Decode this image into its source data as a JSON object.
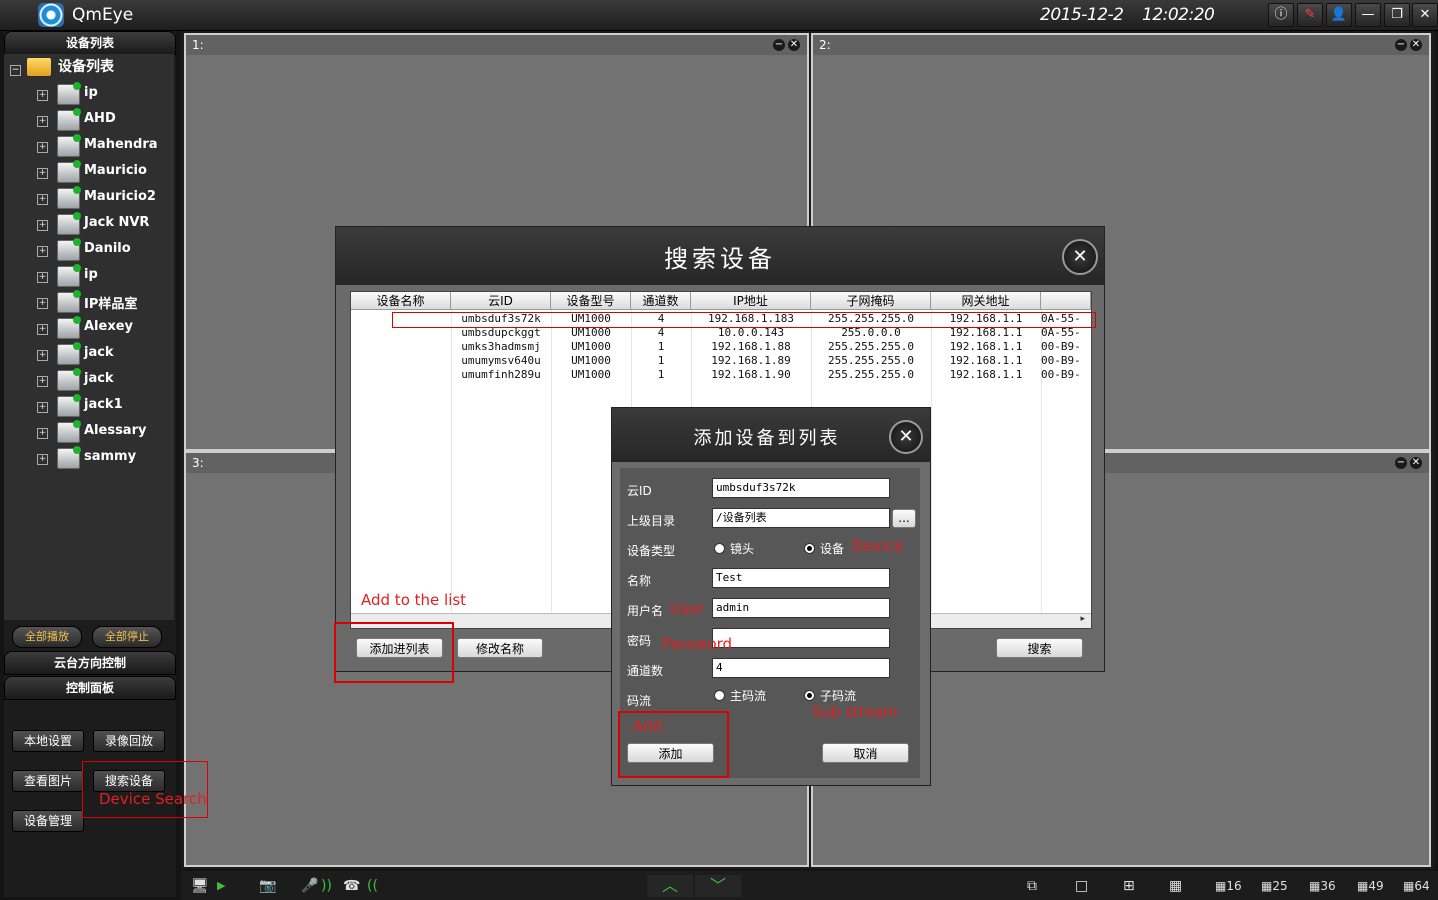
{
  "app": {
    "title": "QmEye",
    "date": "2015-12-2",
    "time": "12:02:20"
  },
  "titlebar_buttons": [
    {
      "name": "info-icon",
      "glyph": "ⓘ"
    },
    {
      "name": "lock-icon",
      "glyph": "✎"
    },
    {
      "name": "user-icon",
      "glyph": "👤"
    },
    {
      "name": "minimize-icon",
      "glyph": "—"
    },
    {
      "name": "restore-icon",
      "glyph": "❐"
    },
    {
      "name": "close-icon",
      "glyph": "✕"
    }
  ],
  "sidebar": {
    "header": "设备列表",
    "root_label": "设备列表",
    "devices": [
      "ip",
      "AHD",
      "Mahendra",
      "Mauricio",
      "Mauricio2",
      "Jack NVR",
      "Danilo",
      "ip",
      "IP样品室",
      "Alexey",
      "jack",
      "jack",
      "jack1",
      "Alessary",
      "sammy"
    ],
    "play_all": "全部播放",
    "stop_all": "全部停止",
    "ptz": "云台方向控制",
    "control_panel": "控制面板",
    "local_settings": "本地设置",
    "playback": "录像回放",
    "view_pictures": "查看图片",
    "search_device": "搜索设备",
    "device_management": "设备管理"
  },
  "panes": [
    "1:",
    "2:",
    "3:"
  ],
  "search_dialog": {
    "title": "搜索设备",
    "columns": [
      "设备名称",
      "云ID",
      "设备型号",
      "通道数",
      "IP地址",
      "子网掩码",
      "网关地址"
    ],
    "rows": [
      [
        "",
        "umbsduf3s72k",
        "UM1000",
        "4",
        "192.168.1.183",
        "255.255.255.0",
        "192.168.1.1",
        "0A-55-"
      ],
      [
        "",
        "umbsdupckggt",
        "UM1000",
        "4",
        "10.0.0.143",
        "255.0.0.0",
        "192.168.1.1",
        "0A-55-"
      ],
      [
        "",
        "umks3hadmsmj",
        "UM1000",
        "1",
        "192.168.1.88",
        "255.255.255.0",
        "192.168.1.1",
        "00-B9-"
      ],
      [
        "",
        "umumymsv640u",
        "UM1000",
        "1",
        "192.168.1.89",
        "255.255.255.0",
        "192.168.1.1",
        "00-B9-"
      ],
      [
        "",
        "umumfinh289u",
        "UM1000",
        "1",
        "192.168.1.90",
        "255.255.255.0",
        "192.168.1.1",
        "00-B9-"
      ]
    ],
    "add_to_list": "添加进列表",
    "rename": "修改名称",
    "search": "搜索"
  },
  "add_dialog": {
    "title": "添加设备到列表",
    "cloud_id_label": "云ID",
    "cloud_id_value": "umbsduf3s72k",
    "parent_dir_label": "上级目录",
    "parent_dir_value": "/设备列表",
    "browse_label": "...",
    "device_type_label": "设备类型",
    "type_camera": "镜头",
    "type_device": "设备",
    "name_label": "名称",
    "name_value": "Test",
    "username_label": "用户名",
    "username_value": "admin",
    "password_label": "密码",
    "password_value": "",
    "channels_label": "通道数",
    "channels_value": "4",
    "stream_label": "码流",
    "main_stream": "主码流",
    "sub_stream": "子码流",
    "add_button": "添加",
    "cancel_button": "取消"
  },
  "annotations": {
    "add_to_list": "Add to the list",
    "device": "Device",
    "user": "User",
    "password": "Password",
    "sub_stream": "Sub stream",
    "add": "Add",
    "device_search": "Device Search"
  },
  "colors": {
    "annotation_red": "#e41f1f",
    "pane_grey": "#727272",
    "selected_gold": "#f2c14b"
  }
}
